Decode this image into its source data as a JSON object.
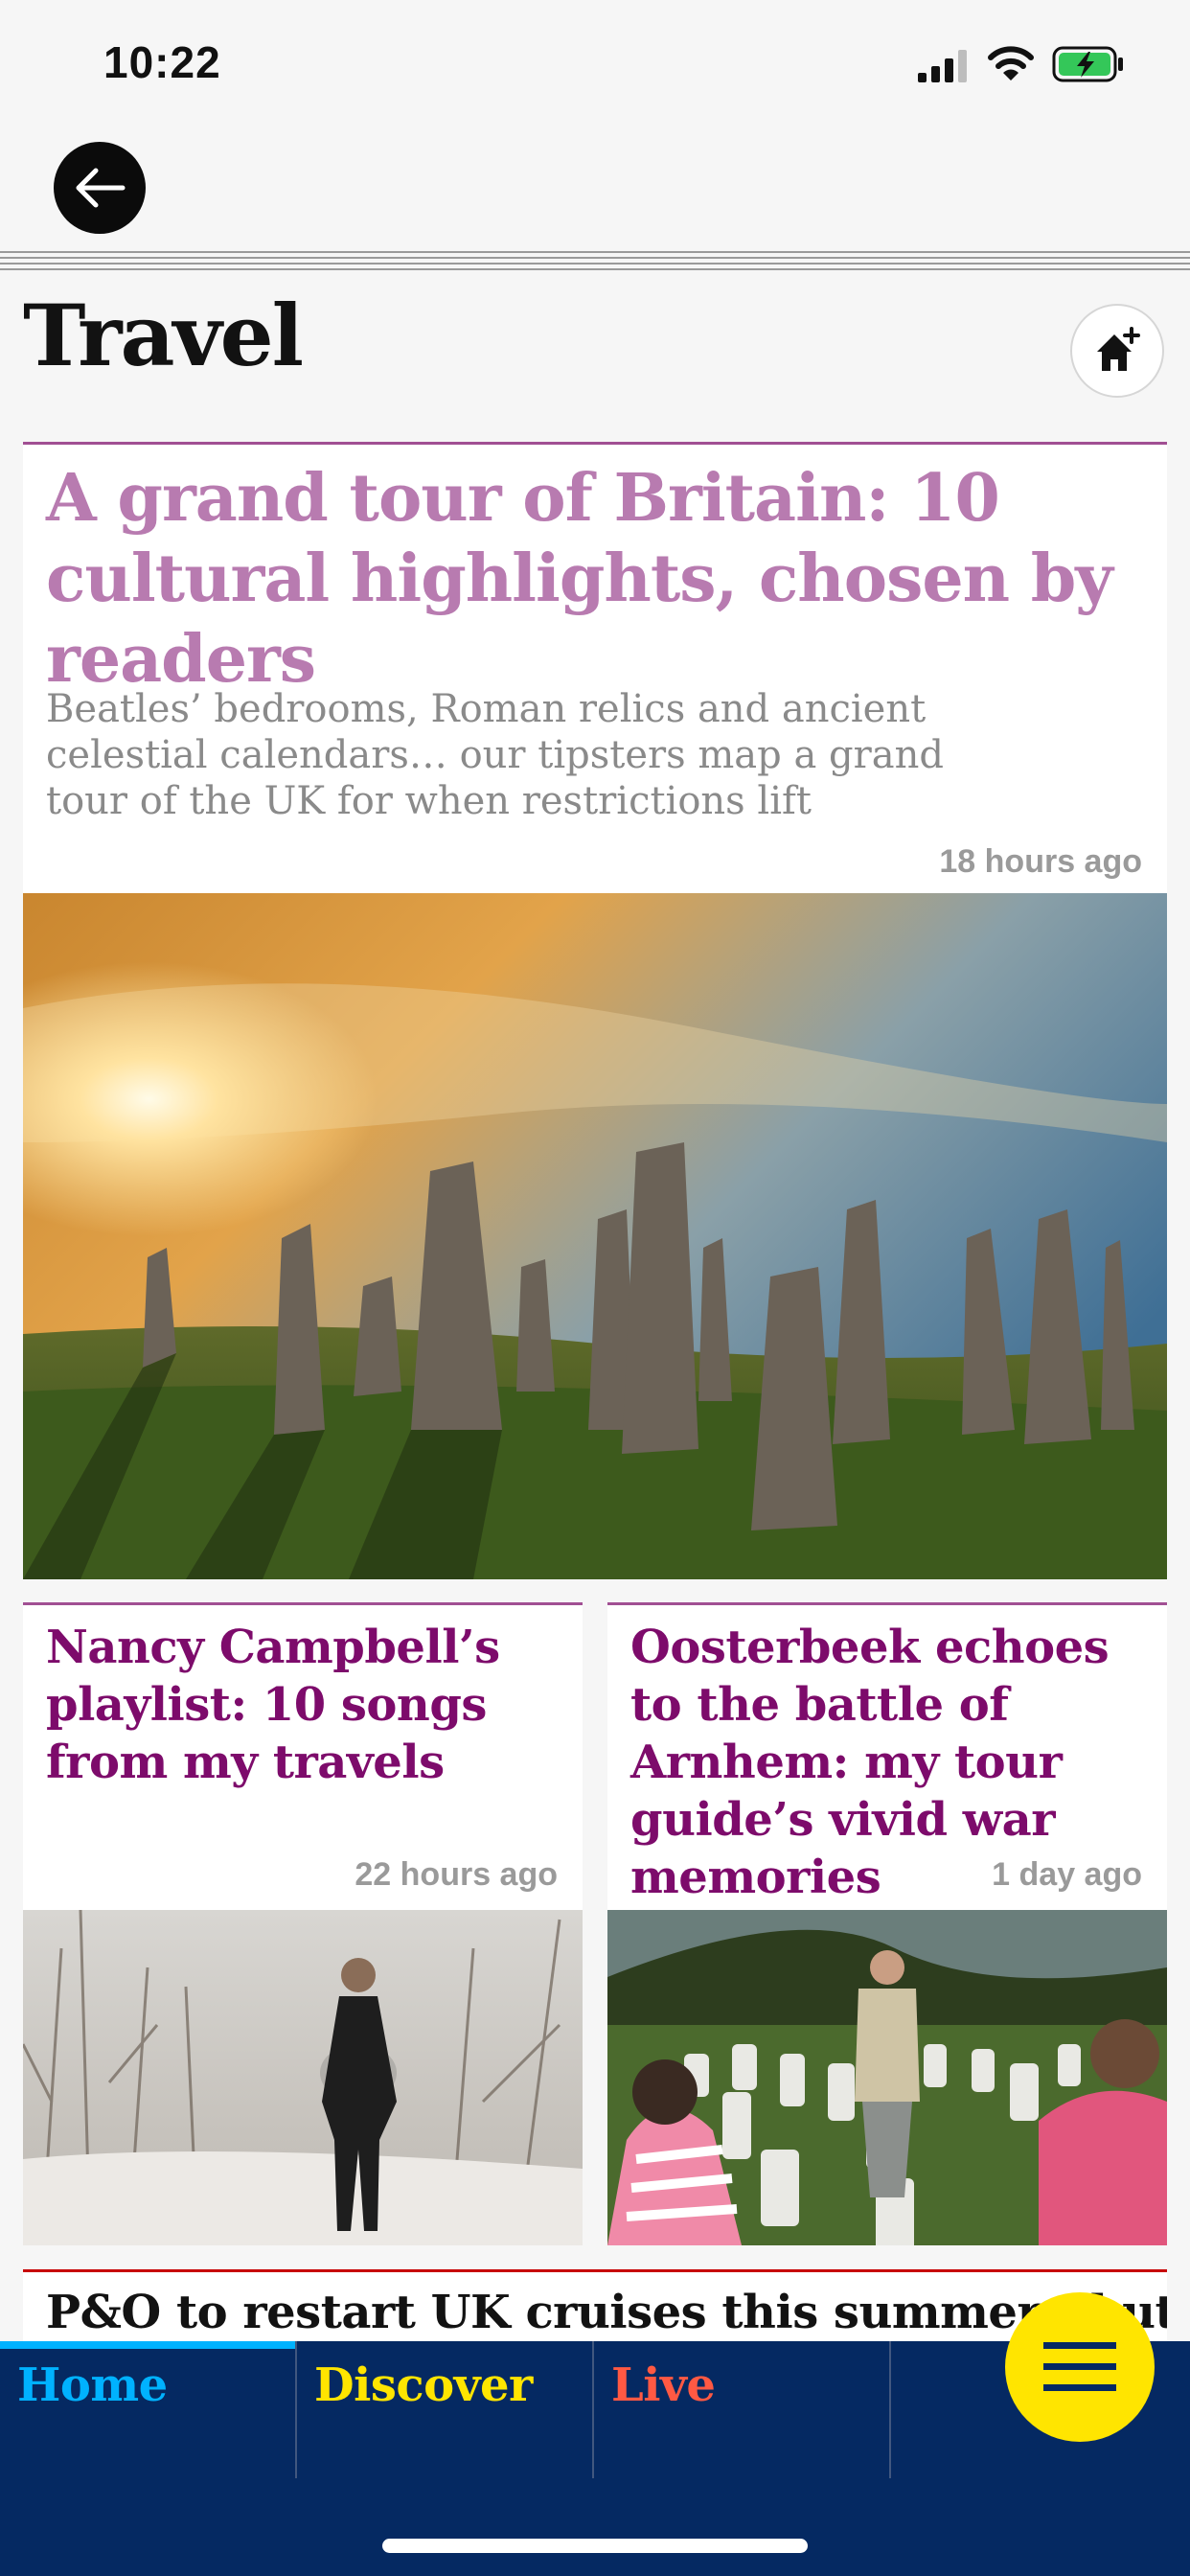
{
  "status": {
    "time": "10:22"
  },
  "section": {
    "title": "Travel"
  },
  "main": {
    "headline": "A grand tour of Britain: 10 cultural highlights, chosen by readers",
    "standfirst": "Beatles’ bedrooms, Roman relics and ancient celestial calendars… our tipsters map a grand tour of the UK for when restrictions lift",
    "age": "18 hours ago"
  },
  "cards": [
    {
      "headline": "Nancy Campbell’s playlist: 10 songs from my travels",
      "age": "22 hours ago"
    },
    {
      "headline": "Oosterbeek echoes to the battle of Arnhem: my tour guide’s vivid war memories",
      "age": "1 day ago"
    }
  ],
  "bottom": {
    "headline": "P&O to restart UK cruises this summer - but only for"
  },
  "nav": {
    "tabs": [
      {
        "label": "Home",
        "color": "#00b2ff"
      },
      {
        "label": "Discover",
        "color": "#ffe500"
      },
      {
        "label": "Live",
        "color": "#ff5943"
      },
      {
        "label": "",
        "color": "#ffffff"
      }
    ]
  },
  "colors": {
    "accent_lifestyle": "#a14f93",
    "headline_main": "#b87bb0",
    "headline_sub": "#7d0b6b",
    "nav_bg": "#052962",
    "menu_button": "#ffe500",
    "news_rule": "#c70000"
  },
  "icons": [
    "back-arrow-icon",
    "home-add-icon",
    "menu-icon",
    "signal-icon",
    "wifi-icon",
    "battery-charging-icon"
  ]
}
